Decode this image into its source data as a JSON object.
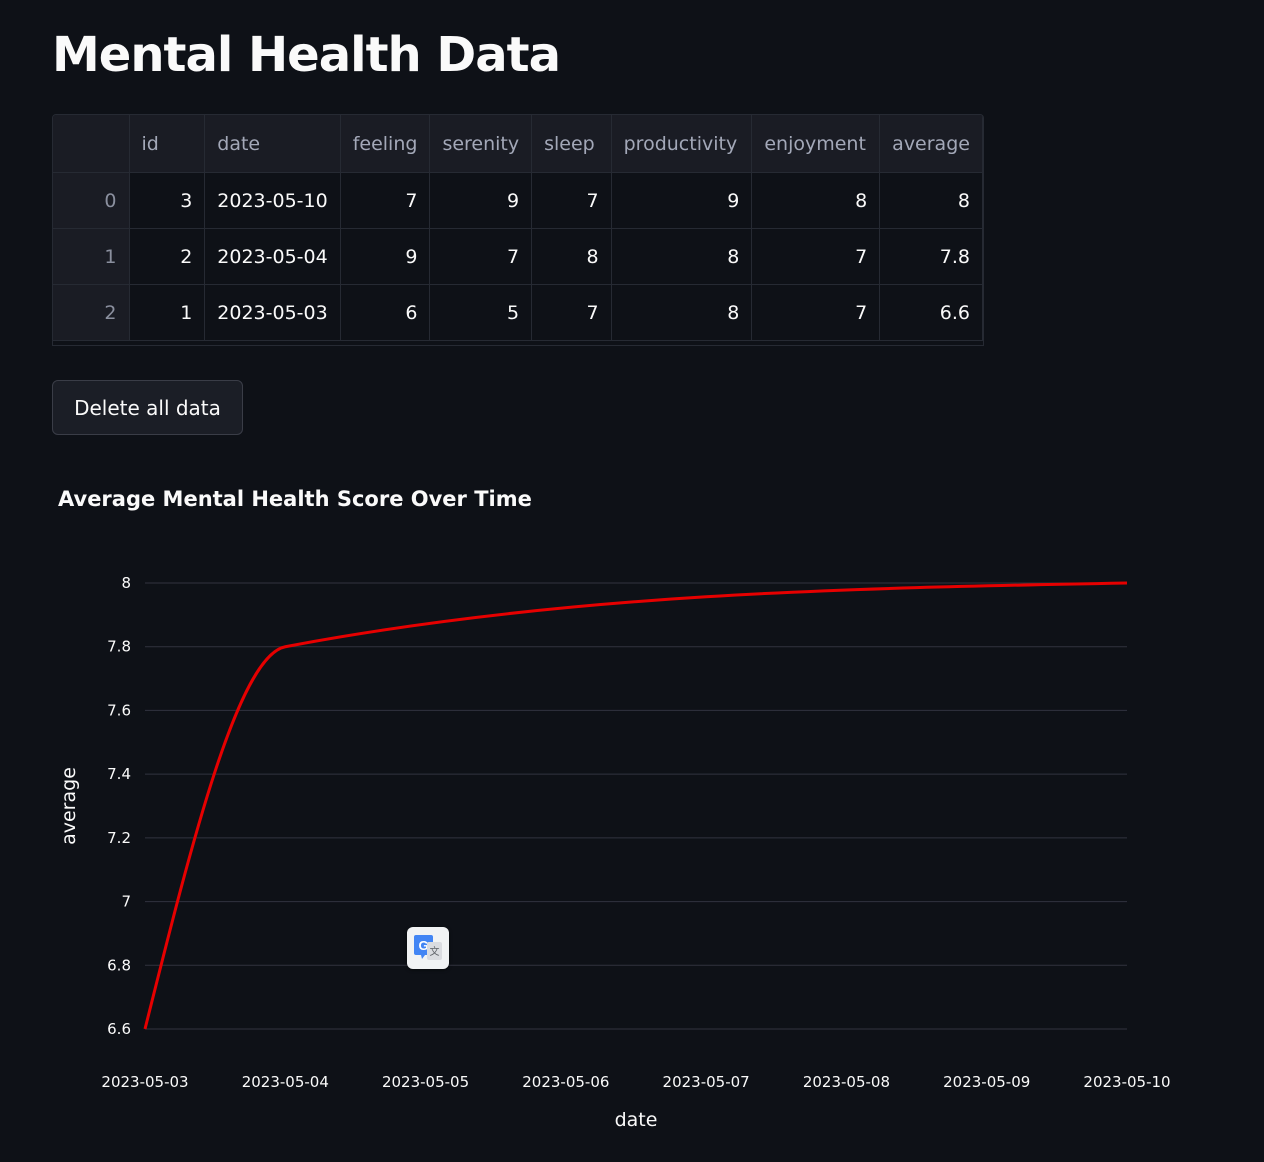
{
  "page": {
    "title": "Mental Health Data"
  },
  "table": {
    "columns": [
      "",
      "id",
      "date",
      "feeling",
      "serenity",
      "sleep",
      "productivity",
      "enjoyment",
      "average"
    ],
    "rows": [
      [
        "0",
        "3",
        "2023-05-10",
        "7",
        "9",
        "7",
        "9",
        "8",
        "8"
      ],
      [
        "1",
        "2",
        "2023-05-04",
        "9",
        "7",
        "8",
        "8",
        "7",
        "7.8"
      ],
      [
        "2",
        "1",
        "2023-05-03",
        "6",
        "5",
        "7",
        "8",
        "7",
        "6.6"
      ]
    ]
  },
  "actions": {
    "delete_label": "Delete all data"
  },
  "chart_data": {
    "type": "line",
    "title": "Average Mental Health Score Over Time",
    "xlabel": "date",
    "ylabel": "average",
    "x_ticks": [
      "2023-05-03",
      "2023-05-04",
      "2023-05-05",
      "2023-05-06",
      "2023-05-07",
      "2023-05-08",
      "2023-05-09",
      "2023-05-10"
    ],
    "y_ticks": [
      6.6,
      6.8,
      7,
      7.2,
      7.4,
      7.6,
      7.8,
      8
    ],
    "ylim": [
      6.6,
      8
    ],
    "xlim": [
      "2023-05-03",
      "2023-05-10"
    ],
    "interpolation": "monotone",
    "series": [
      {
        "color": "#e60000",
        "points": [
          {
            "x": "2023-05-03",
            "y": 6.6
          },
          {
            "x": "2023-05-04",
            "y": 7.8
          },
          {
            "x": "2023-05-10",
            "y": 8
          }
        ]
      }
    ],
    "grid": true
  },
  "overlay": {
    "translate_icon": "google-translate-icon"
  }
}
